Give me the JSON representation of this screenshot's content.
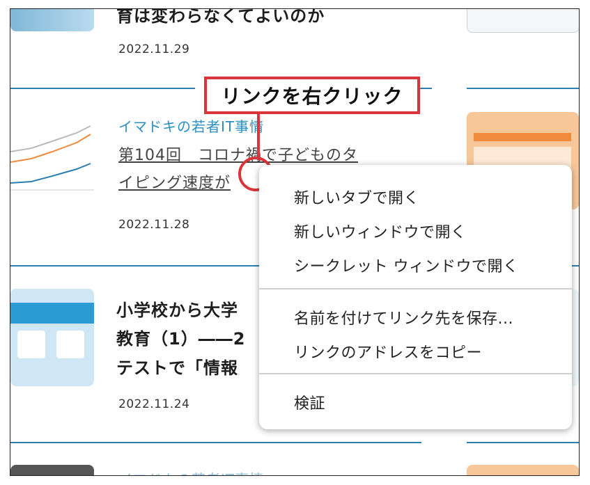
{
  "callout": {
    "label": "リンクを右クリック"
  },
  "articles": [
    {
      "title_fragment": "育は変わらなくてよいのか",
      "date": "2022.11.29"
    },
    {
      "category": "イマドキの若者IT事情",
      "title_line1": "第104回　コロナ禍で子どものタ",
      "title_line2": "イピング速度が",
      "date": "2022.11.28"
    },
    {
      "title_line1": "小学校から大学",
      "title_line2": "教育（1）――2",
      "title_line3": "テストで「情報",
      "date": "2022.11.24"
    },
    {
      "category": "イマドキの若者IT事情"
    }
  ],
  "context_menu": {
    "items": [
      {
        "label": "新しいタブで開く"
      },
      {
        "label": "新しいウィンドウで開く"
      },
      {
        "label": "シークレット ウィンドウで開く"
      },
      {
        "label": "名前を付けてリンク先を保存..."
      },
      {
        "label": "リンクのアドレスをコピー"
      },
      {
        "label": "検証"
      }
    ]
  },
  "colors": {
    "accent_blue": "#2b7fb0",
    "callout_red": "#d9353a"
  }
}
